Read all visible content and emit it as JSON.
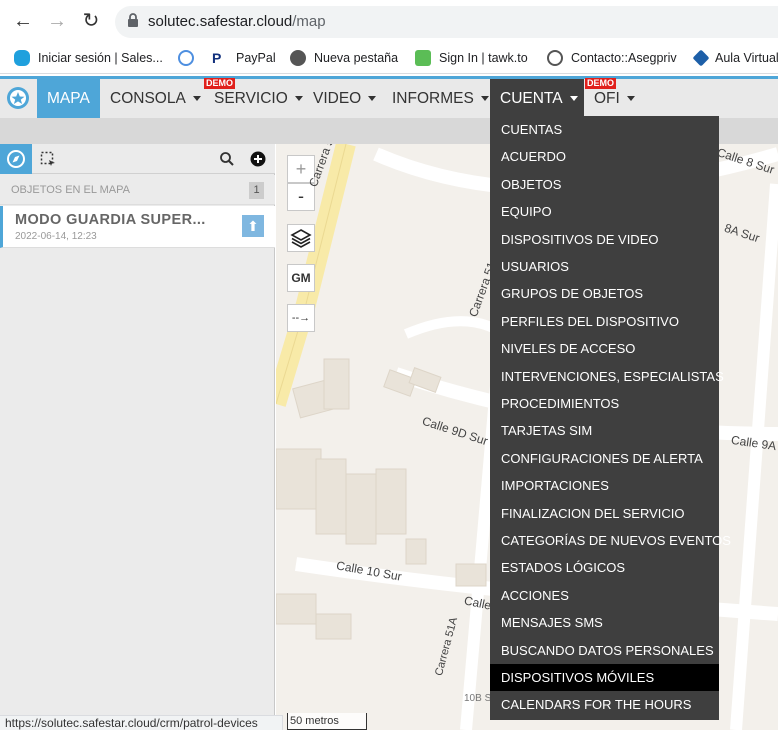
{
  "browser": {
    "url_host": "solutec.safestar.cloud",
    "url_path": "/map",
    "bookmarks": [
      {
        "label": "Iniciar sesión | Sales...",
        "icon": "salesforce-icon"
      },
      {
        "label": "",
        "icon": "shield-icon"
      },
      {
        "label": "PayPal",
        "icon": "paypal-icon"
      },
      {
        "label": "Nueva pestaña",
        "icon": "globe-icon"
      },
      {
        "label": "Sign In | tawk.to",
        "icon": "tawk-icon"
      },
      {
        "label": "Contacto::Asegpriv",
        "icon": "globe-icon"
      },
      {
        "label": "Aula Virtual",
        "icon": "aula-icon"
      }
    ],
    "status_url": "https://solutec.safestar.cloud/crm/patrol-devices"
  },
  "nav": {
    "items": [
      {
        "label": "MAPA",
        "active": true
      },
      {
        "label": "CONSOLA"
      },
      {
        "label": "SERVICIO",
        "badge": "DEMO"
      },
      {
        "label": "VIDEO"
      },
      {
        "label": "INFORMES"
      },
      {
        "label": "CUENTA",
        "open": true
      },
      {
        "label": "OFI",
        "badge": "DEMO"
      }
    ]
  },
  "left_panel": {
    "objects_header": "OBJETOS EN EL MAPA",
    "objects_count": "1",
    "object": {
      "name": "MODO GUARDIA SUPER...",
      "date": "2022-06-14, 12:23"
    }
  },
  "map": {
    "zoom_in": "+",
    "zoom_out": "-",
    "gm_label": "GM",
    "route_label": "--→",
    "scale_label": "50 metros",
    "streets": [
      "Carrera 52",
      "Calle 8 Sur",
      "8A Sur",
      "Carrera 51",
      "Calle 9D Sur",
      "Calle 9A",
      "Calle 10 Sur",
      "Calle",
      "Carrera 51A",
      "10B S"
    ]
  },
  "dropdown": {
    "items": [
      "CUENTAS",
      "ACUERDO",
      "OBJETOS",
      "EQUIPO",
      "DISPOSITIVOS DE VIDEO",
      "USUARIOS",
      "GRUPOS DE OBJETOS",
      "PERFILES DEL DISPOSITIVO",
      "NIVELES DE ACCESO",
      "INTERVENCIONES, ESPECIALISTAS",
      "PROCEDIMIENTOS",
      "TARJETAS SIM",
      "CONFIGURACIONES DE ALERTA",
      "IMPORTACIONES",
      "FINALIZACION DEL SERVICIO",
      "CATEGORÍAS DE NUEVOS EVENTOS",
      "ESTADOS LÓGICOS",
      "ACCIONES",
      "MENSAJES SMS",
      "BUSCANDO DATOS PERSONALES",
      "DISPOSITIVOS MÓVILES",
      "CALENDARS FOR THE HOURS"
    ],
    "highlighted_index": 20
  },
  "colors": {
    "accent": "#4ea6d8",
    "menu_bg": "#3f3f3f",
    "demo_badge": "#e0201c"
  }
}
